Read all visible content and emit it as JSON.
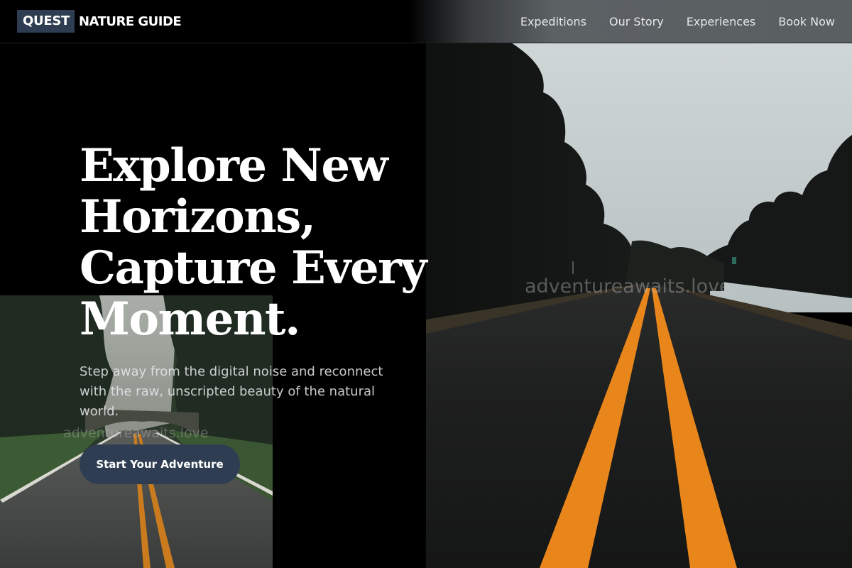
{
  "header": {
    "logo_box": "QUEST",
    "logo_text": "NATURE GUIDE",
    "nav": [
      {
        "label": "Expeditions"
      },
      {
        "label": "Our Story"
      },
      {
        "label": "Experiences"
      },
      {
        "label": "Book Now"
      }
    ]
  },
  "hero": {
    "headline": "Explore New Horizons, Capture Every Moment.",
    "subtitle": "Step away from the digital noise and reconnect with the raw, unscripted beauty of the natural world.",
    "cta_label": "Start Your Adventure"
  },
  "watermarks": {
    "main": "adventureawaits.love",
    "inset": "adventureawaits.love"
  },
  "colors": {
    "accent": "#2e3d52",
    "road_line": "#e8861c",
    "background": "#000000"
  }
}
